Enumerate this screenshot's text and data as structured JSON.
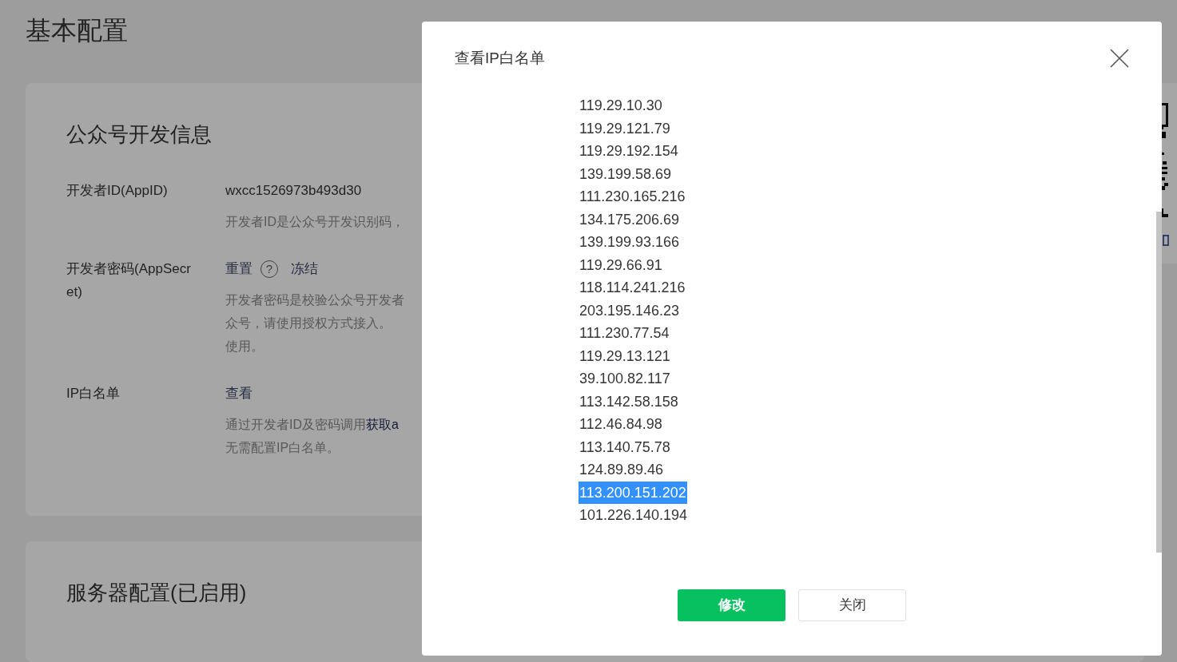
{
  "page_title": "基本配置",
  "cards": [
    {
      "title": "公众号开发信息",
      "rows": [
        {
          "label": "开发者ID(AppID)",
          "value": "wxcc1526973b493d30",
          "desc": [
            [
              {
                "text": "开发者ID是公众号开发识别码，",
                "link": false
              }
            ]
          ]
        },
        {
          "label": "开发者密码(AppSecret)",
          "actions": [
            {
              "text": "重置",
              "kind": "link"
            },
            {
              "text": "?",
              "kind": "help"
            },
            {
              "text": "冻结",
              "kind": "link"
            }
          ],
          "desc": [
            [
              {
                "text": "开发者密码是校验公众号开发者",
                "link": false
              }
            ],
            [
              {
                "text": "众号，请使用授权方式接入。",
                "link": false
              }
            ],
            [
              {
                "text": "使用。",
                "link": false
              }
            ]
          ]
        },
        {
          "label": "IP白名单",
          "actions": [
            {
              "text": "查看",
              "kind": "link"
            }
          ],
          "desc": [
            [
              {
                "text": "通过开发者ID及密码调用",
                "link": false
              },
              {
                "text": "获取a",
                "link": true
              }
            ],
            [
              {
                "text": "无需配置IP白名单。",
                "link": false
              }
            ]
          ]
        }
      ]
    },
    {
      "title": "服务器配置(已启用)"
    }
  ],
  "dialog": {
    "title": "查看IP白名单",
    "ips": [
      {
        "text": "119.29.10.30",
        "selected": false
      },
      {
        "text": "119.29.121.79",
        "selected": false
      },
      {
        "text": "119.29.192.154",
        "selected": false
      },
      {
        "text": "139.199.58.69",
        "selected": false
      },
      {
        "text": "111.230.165.216",
        "selected": false
      },
      {
        "text": "134.175.206.69",
        "selected": false
      },
      {
        "text": "139.199.93.166",
        "selected": false
      },
      {
        "text": "119.29.66.91",
        "selected": false
      },
      {
        "text": "118.114.241.216",
        "selected": false
      },
      {
        "text": "203.195.146.23",
        "selected": false
      },
      {
        "text": "111.230.77.54",
        "selected": false
      },
      {
        "text": "119.29.13.121",
        "selected": false
      },
      {
        "text": "39.100.82.117",
        "selected": false
      },
      {
        "text": "113.142.58.158",
        "selected": false
      },
      {
        "text": "112.46.84.98",
        "selected": false
      },
      {
        "text": "113.140.75.78",
        "selected": false
      },
      {
        "text": "124.89.89.46",
        "selected": false
      },
      {
        "text": "113.200.151.202",
        "selected": true
      },
      {
        "text": "101.226.140.194",
        "selected": false
      }
    ],
    "buttons": [
      {
        "label": "修改",
        "kind": "primary"
      },
      {
        "label": "关闭",
        "kind": "default"
      }
    ]
  }
}
